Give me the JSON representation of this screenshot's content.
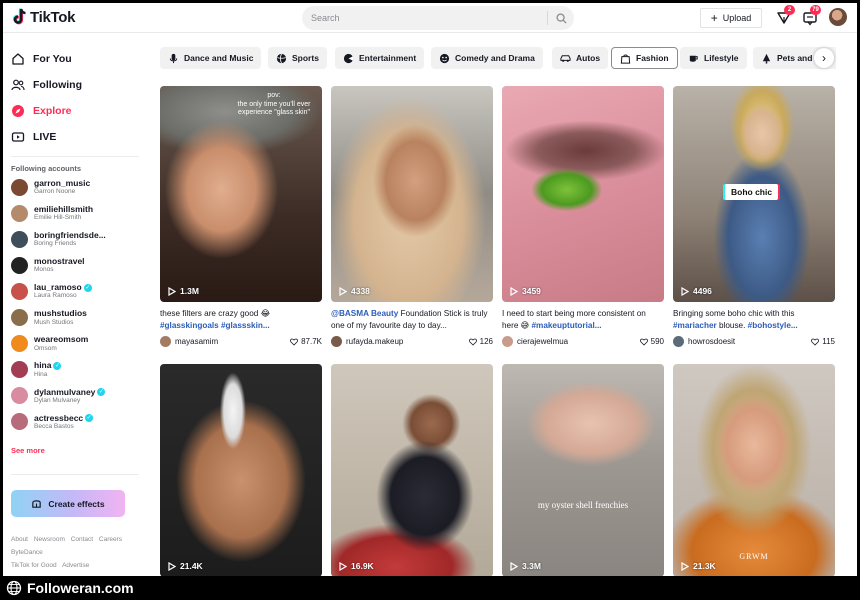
{
  "app": {
    "name": "TikTok"
  },
  "header": {
    "search_placeholder": "Search",
    "upload_label": "Upload",
    "inbox_badge": "2",
    "messages_badge": "79"
  },
  "sidebar": {
    "nav": [
      {
        "label": "For You",
        "icon": "home-icon"
      },
      {
        "label": "Following",
        "icon": "following-icon"
      },
      {
        "label": "Explore",
        "icon": "compass-icon"
      },
      {
        "label": "LIVE",
        "icon": "live-icon"
      }
    ],
    "following_title": "Following accounts",
    "accounts": [
      {
        "username": "garron_music",
        "name": "Garron Noone",
        "verified": false,
        "color": "#7a4a32"
      },
      {
        "username": "emiliehillsmith",
        "name": "Emilie Hill-Smith",
        "verified": false,
        "color": "#b48a6a"
      },
      {
        "username": "boringfriendsde...",
        "name": "Boring Friends",
        "verified": false,
        "color": "#3d4f5c"
      },
      {
        "username": "monostravel",
        "name": "Monos",
        "verified": false,
        "color": "#222222"
      },
      {
        "username": "lau_ramoso",
        "name": "Laura Ramoso",
        "verified": true,
        "color": "#c7524a"
      },
      {
        "username": "mushstudios",
        "name": "Mush Studios",
        "verified": false,
        "color": "#8a6d4a"
      },
      {
        "username": "weareomsom",
        "name": "Omsom",
        "verified": false,
        "color": "#f08a1c"
      },
      {
        "username": "hina",
        "name": "Hina",
        "verified": true,
        "color": "#a33d54"
      },
      {
        "username": "dylanmulvaney",
        "name": "Dylan Mulvaney",
        "verified": true,
        "color": "#d98ba2"
      },
      {
        "username": "actressbecc",
        "name": "Becca Bastos",
        "verified": true,
        "color": "#b86b7a"
      }
    ],
    "see_more": "See more",
    "create_effects": "Create effects",
    "footer_links": [
      "About",
      "Newsroom",
      "Contact",
      "Careers",
      "ByteDance",
      "TikTok for Good",
      "Advertise"
    ]
  },
  "categories": [
    {
      "label": "Dance and Music",
      "icon": "microphone-icon",
      "selected": false
    },
    {
      "label": "Sports",
      "icon": "ball-icon",
      "selected": false
    },
    {
      "label": "Entertainment",
      "icon": "entertainment-icon",
      "selected": false
    },
    {
      "label": "Comedy and Drama",
      "icon": "comedy-mask-icon",
      "selected": false
    },
    {
      "label": "Autos",
      "icon": "car-icon",
      "selected": false
    },
    {
      "label": "Fashion",
      "icon": "shopping-bag-icon",
      "selected": true
    },
    {
      "label": "Lifestyle",
      "icon": "cup-icon",
      "selected": false
    },
    {
      "label": "Pets and N",
      "icon": "pet-icon",
      "selected": false
    }
  ],
  "videos": [
    {
      "views": "1.3M",
      "overlay": "pov:\nthe only time you'll ever\nexperience \"glass skin\"",
      "caption_text": "these filters are crazy good 😂 ",
      "caption_tags": "#glasskingoals #glassskin...",
      "user": "mayasamim",
      "likes": "87.7K"
    },
    {
      "views": "4338",
      "caption_tags": "@BASMA Beauty",
      "caption_text": " Foundation Stick is truly one of my favourite day to day...",
      "user": "rufayda.makeup",
      "likes": "126"
    },
    {
      "views": "3459",
      "caption_text": "I need to start being more consistent on here 😅 ",
      "caption_tags": "#makeuptutorial...",
      "user": "cierajewelmua",
      "likes": "590"
    },
    {
      "views": "4496",
      "overlay": "Boho chic",
      "caption_text": "Bringing some boho chic with this ",
      "caption_tags": "#mariacher",
      "caption_text2": " blouse. ",
      "caption_tags2": "#bohostyle...",
      "user": "howrosdoesit",
      "likes": "115"
    },
    {
      "views": "21.4K"
    },
    {
      "views": "16.9K"
    },
    {
      "views": "3.3M",
      "overlay": "my oyster shell frenchies"
    },
    {
      "views": "21.3K",
      "overlay": "GRWM"
    }
  ],
  "watermark": "Followeran.com"
}
